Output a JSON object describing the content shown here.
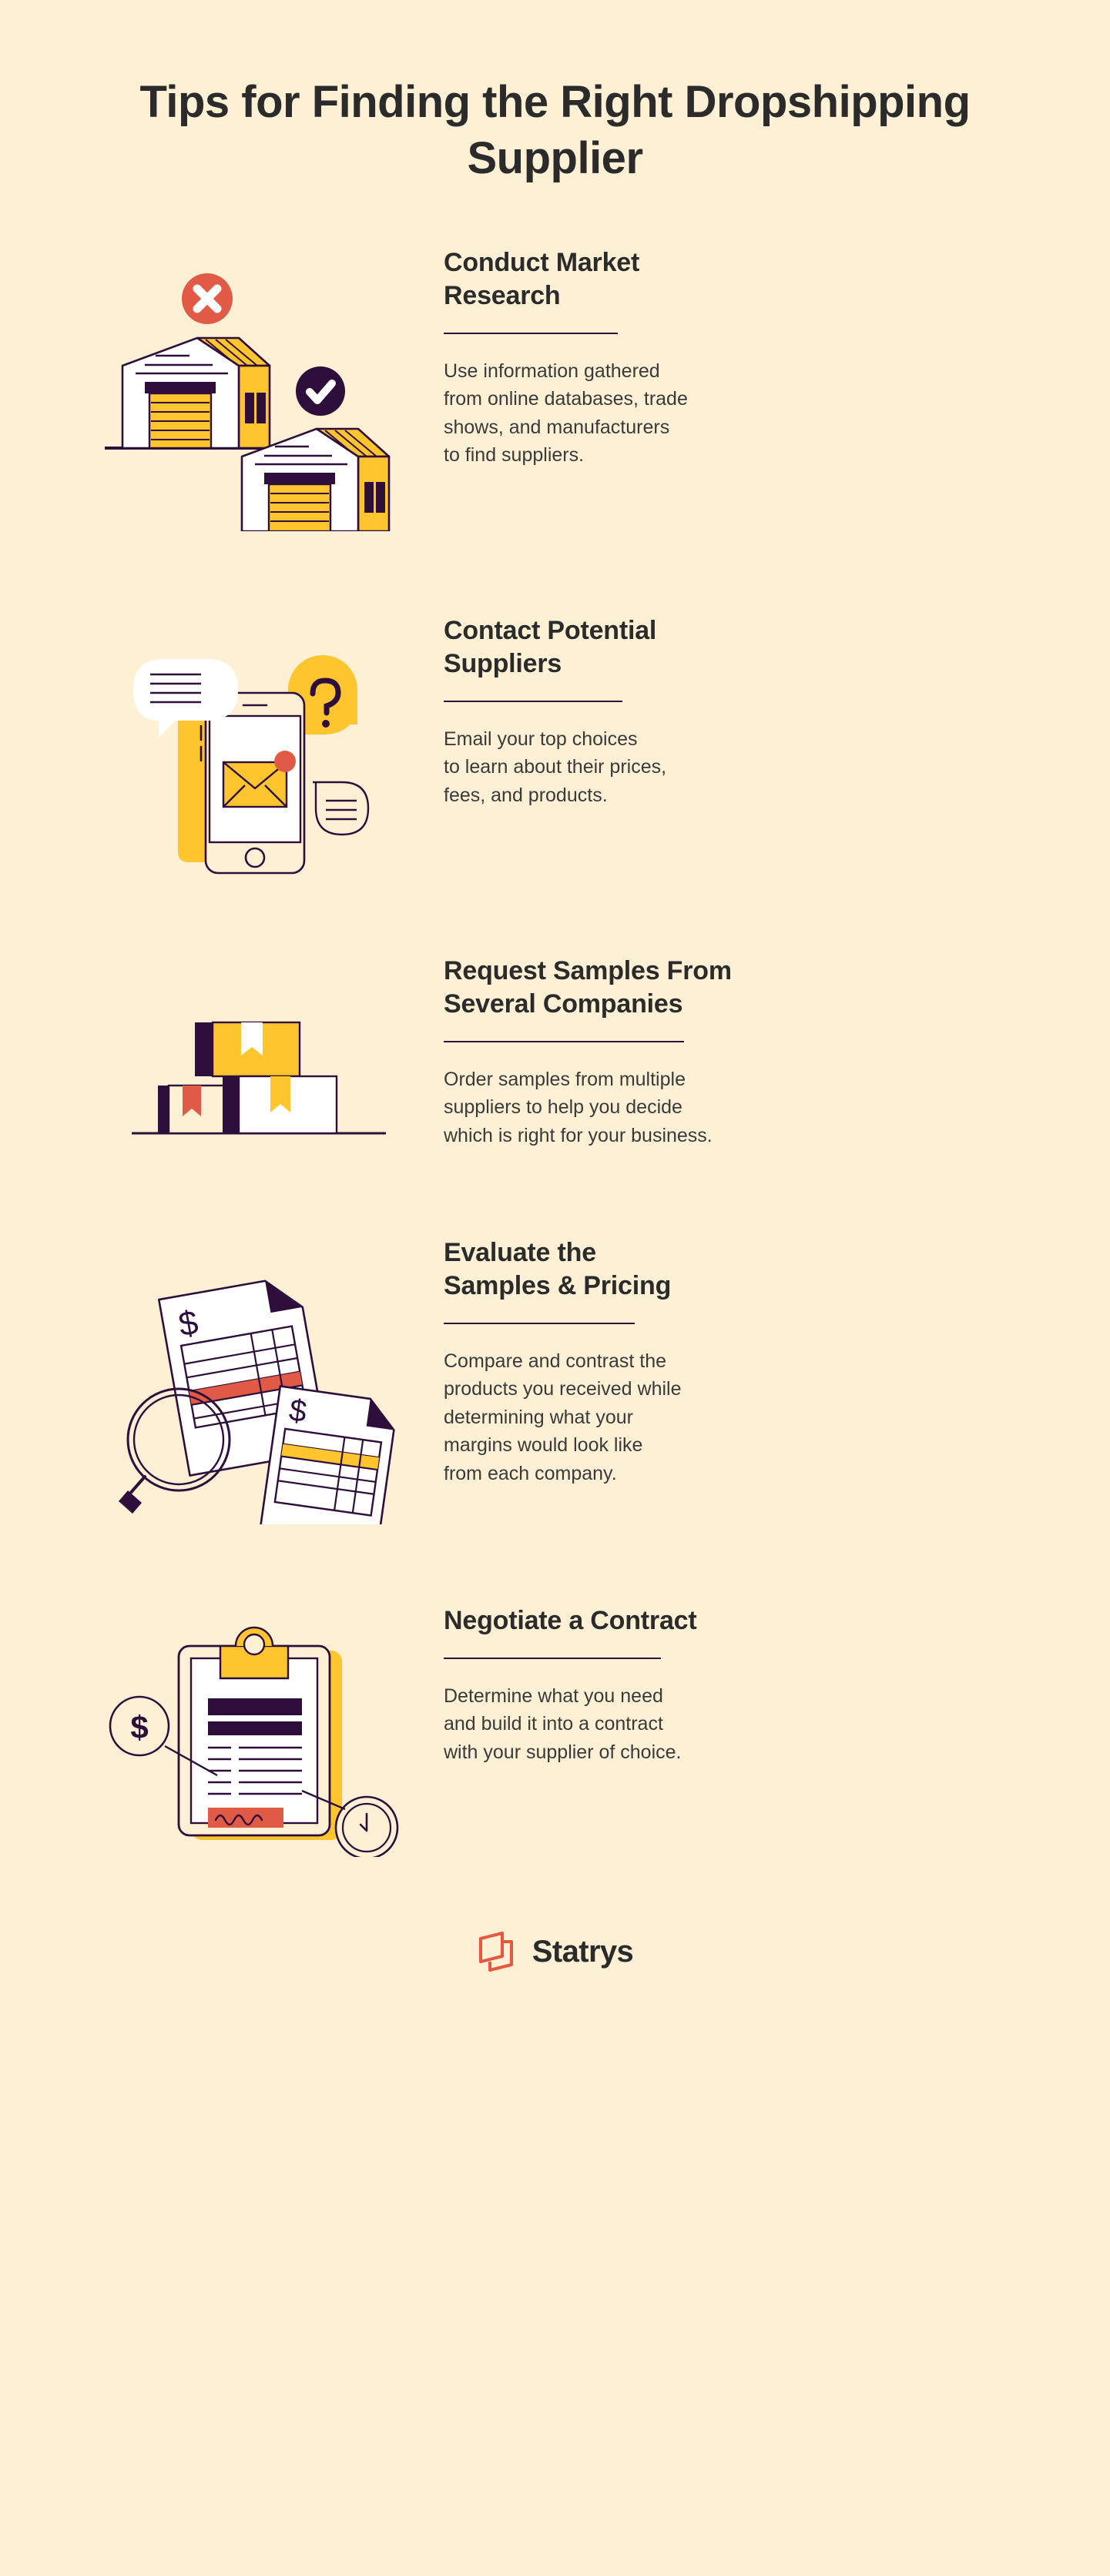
{
  "title": "Tips for Finding the Right\nDropshipping Supplier",
  "colors": {
    "background": "#FDF0D5",
    "purple": "#2E0F3C",
    "yellow": "#FFC52F",
    "red": "#E05A45",
    "white": "#FFFFFF",
    "text_dark": "#2B2B2B",
    "logo_orange": "#E8563F"
  },
  "sections": [
    {
      "heading": "Conduct Market\nResearch",
      "body": "Use information gathered\nfrom online databases, trade\nshows, and manufacturers\nto find suppliers.",
      "illustration": "warehouses-compare-illustration",
      "icons": [
        "close-circle-icon",
        "check-circle-icon",
        "warehouse-icon"
      ]
    },
    {
      "heading": "Contact Potential\nSuppliers",
      "body": "Email your top choices\nto learn about their prices,\nfees, and products.",
      "illustration": "smartphone-email-illustration",
      "icons": [
        "speech-bubble-icon",
        "question-mark-icon",
        "envelope-icon",
        "notification-dot-icon",
        "message-bubble-icon"
      ]
    },
    {
      "heading": "Request Samples From\nSeveral Companies",
      "body": "Order samples from multiple\nsuppliers to help you decide\nwhich is right for your business.",
      "illustration": "stacked-boxes-illustration",
      "icons": [
        "package-box-icon"
      ]
    },
    {
      "heading": "Evaluate the\nSamples & Pricing",
      "body": "Compare and contrast the\nproducts you received while\ndetermining what your\nmargins would look like\nfrom each company.",
      "illustration": "price-documents-magnifier-illustration",
      "icons": [
        "document-icon",
        "dollar-sign-icon",
        "magnifier-icon"
      ]
    },
    {
      "heading": "Negotiate a Contract",
      "body": "Determine what you need\nand build it into a contract\nwith your supplier of choice.",
      "illustration": "clipboard-contract-illustration",
      "icons": [
        "clipboard-icon",
        "dollar-circle-icon",
        "clock-circle-icon",
        "signature-icon"
      ]
    }
  ],
  "footer": {
    "brand": "Statrys",
    "logo_icon": "statrys-logo-icon"
  }
}
